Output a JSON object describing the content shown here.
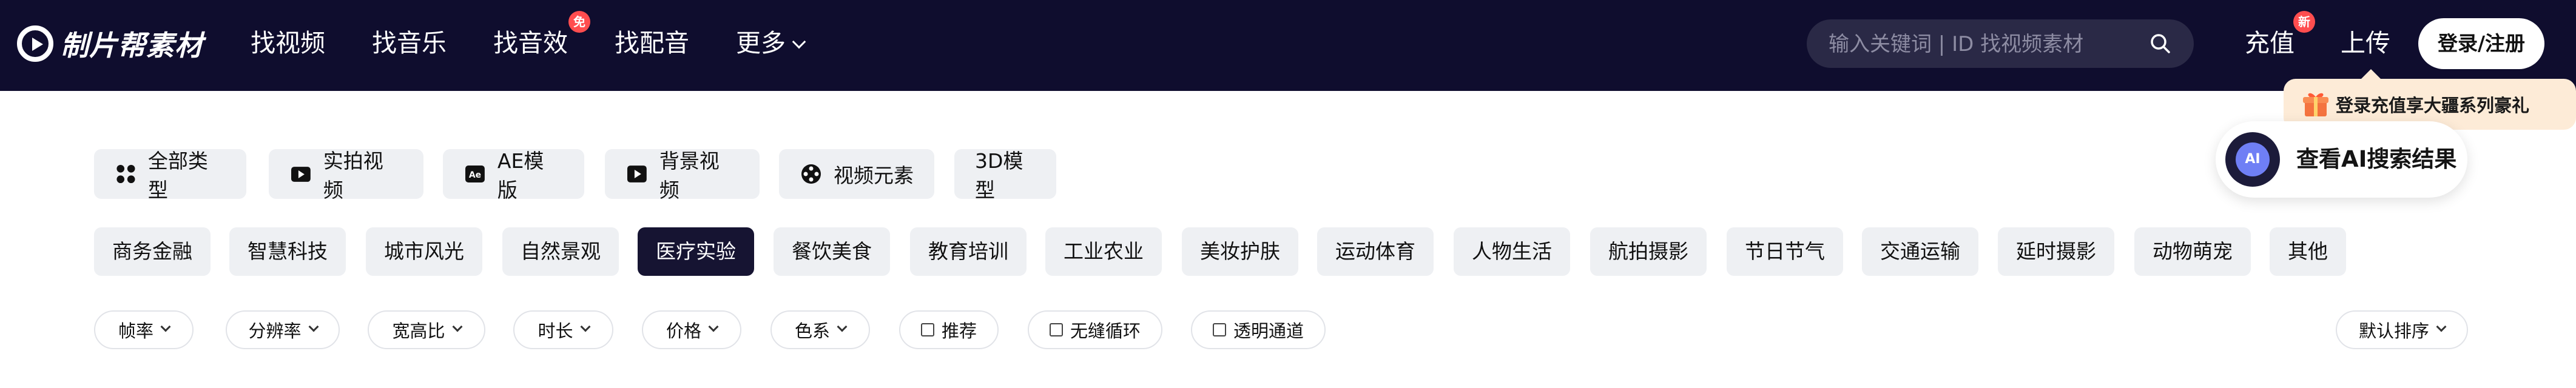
{
  "brand": {
    "name": "制片帮素材"
  },
  "nav": {
    "items": [
      {
        "label": "找视频"
      },
      {
        "label": "找音乐"
      },
      {
        "label": "找音效",
        "badge": "免"
      },
      {
        "label": "找配音"
      },
      {
        "label": "更多"
      }
    ]
  },
  "search": {
    "placeholder": "输入关键词 | ID 找视频素材"
  },
  "account": {
    "topup_label": "充值",
    "topup_badge": "新",
    "upload_label": "上传",
    "login_label": "登录/注册",
    "promo_text": "登录充值享大疆系列豪礼"
  },
  "ai_search": {
    "label": "查看AI搜索结果",
    "icon_text": "AI"
  },
  "types": [
    {
      "label": "全部类型",
      "icon": "grid-icon"
    },
    {
      "label": "实拍视频",
      "icon": "video-camera-icon"
    },
    {
      "label": "AE模版",
      "icon": "ae-icon"
    },
    {
      "label": "背景视频",
      "icon": "play-icon"
    },
    {
      "label": "视频元素",
      "icon": "film-reel-icon"
    },
    {
      "label": "3D模型",
      "icon": ""
    }
  ],
  "categories": [
    {
      "label": "商务金融"
    },
    {
      "label": "智慧科技"
    },
    {
      "label": "城市风光"
    },
    {
      "label": "自然景观"
    },
    {
      "label": "医疗实验",
      "active": true
    },
    {
      "label": "餐饮美食"
    },
    {
      "label": "教育培训"
    },
    {
      "label": "工业农业"
    },
    {
      "label": "美妆护肤"
    },
    {
      "label": "运动体育"
    },
    {
      "label": "人物生活"
    },
    {
      "label": "航拍摄影"
    },
    {
      "label": "节日节气"
    },
    {
      "label": "交通运输"
    },
    {
      "label": "延时摄影"
    },
    {
      "label": "动物萌宠"
    },
    {
      "label": "其他"
    }
  ],
  "filters": {
    "dropdowns": [
      {
        "label": "帧率"
      },
      {
        "label": "分辨率"
      },
      {
        "label": "宽高比"
      },
      {
        "label": "时长"
      },
      {
        "label": "价格"
      },
      {
        "label": "色系"
      }
    ],
    "checkboxes": [
      {
        "label": "推荐",
        "checked": false
      },
      {
        "label": "无缝循环",
        "checked": false
      },
      {
        "label": "透明通道",
        "checked": false
      }
    ],
    "sort_label": "默认排序"
  },
  "colors": {
    "header_bg": "#0f0d2e",
    "pill_bg": "#eef0f3",
    "active_bg": "#161432",
    "badge_red": "#ff4d4f",
    "promo_bg": "#fdebd7",
    "ai_accent": "#6f7ff5"
  }
}
